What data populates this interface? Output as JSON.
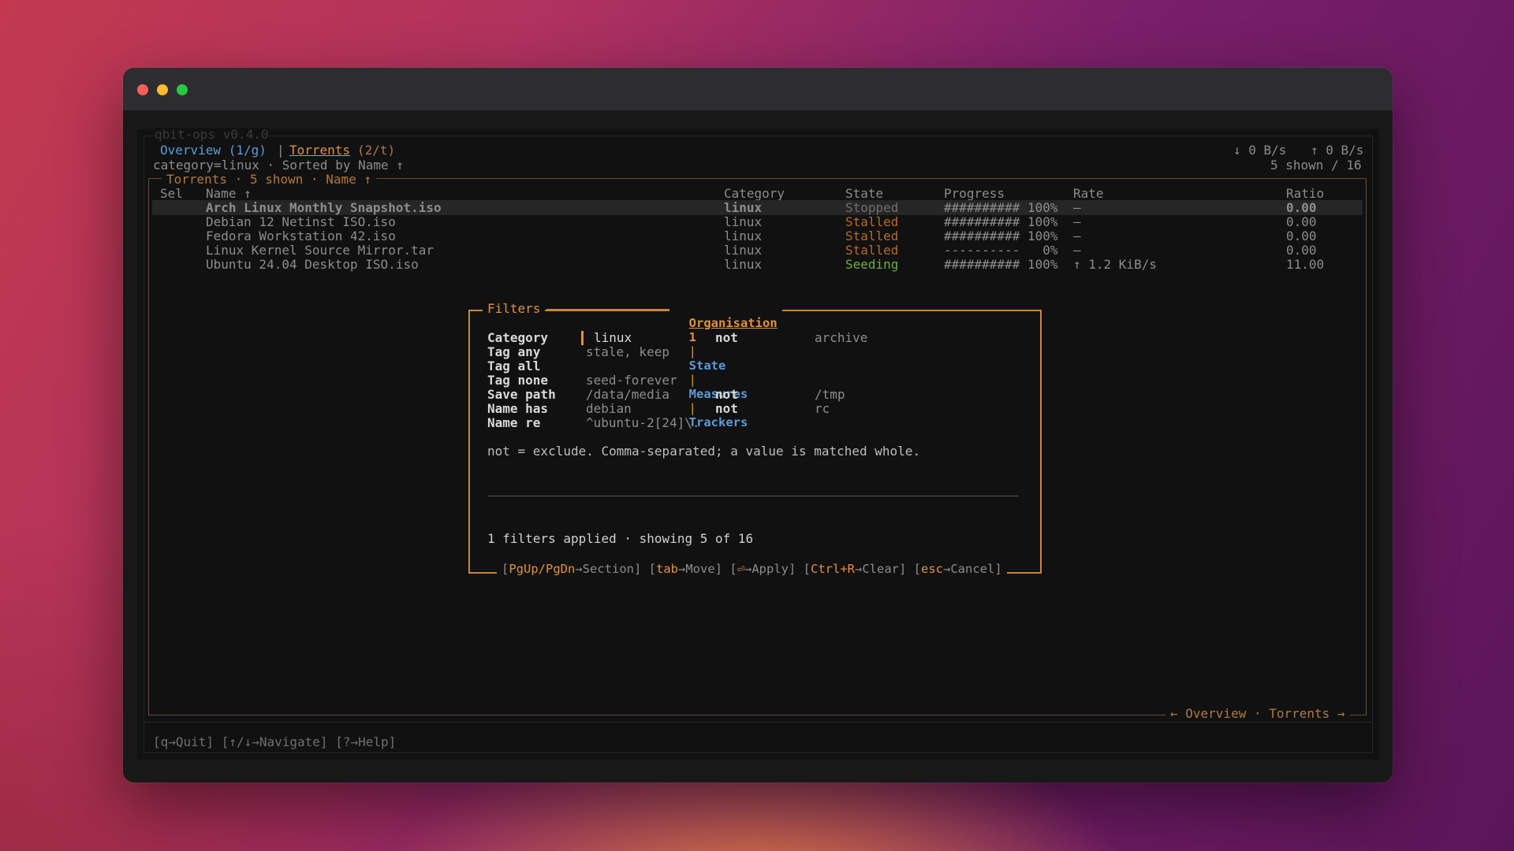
{
  "app": {
    "title": "qbit-ops v0.4.0"
  },
  "tabs": {
    "overview": "Overview (1/g)",
    "sep": "|",
    "torrents": "Torrents",
    "torrents_key": "(2/t)"
  },
  "rates": {
    "down": "↓ 0 B/s",
    "up": "↑ 0 B/s"
  },
  "status_line": "category=linux · Sorted by Name ↑",
  "shown_count": "5 shown / 16",
  "panel_title": "Torrents · 5 shown · Name ↑",
  "table": {
    "headers": {
      "sel": "Sel",
      "name": "Name ↑",
      "category": "Category",
      "state": "State",
      "progress": "Progress",
      "rate": "Rate",
      "ratio": "Ratio"
    },
    "rows": [
      {
        "name": "Arch Linux Monthly Snapshot.iso",
        "category": "linux",
        "state": "Stopped",
        "progress": "########## 100%",
        "rate": "–",
        "ratio": "0.00"
      },
      {
        "name": "Debian 12 Netinst ISO.iso",
        "category": "linux",
        "state": "Stalled",
        "progress": "########## 100%",
        "rate": "–",
        "ratio": "0.00"
      },
      {
        "name": "Fedora Workstation 42.iso",
        "category": "linux",
        "state": "Stalled",
        "progress": "########## 100%",
        "rate": "–",
        "ratio": "0.00"
      },
      {
        "name": "Linux Kernel Source Mirror.tar",
        "category": "linux",
        "state": "Stalled",
        "progress": "----------   0%",
        "rate": "–",
        "ratio": "0.00"
      },
      {
        "name": "Ubuntu 24.04 Desktop ISO.iso",
        "category": "linux",
        "state": "Seeding",
        "progress": "########## 100%",
        "rate": "↑ 1.2 KiB/s",
        "ratio": "11.00"
      }
    ]
  },
  "filters": {
    "title": "Filters",
    "tabs": {
      "organisation": "Organisation",
      "organisation_count": "1",
      "state": "State",
      "measures": "Measures",
      "trackers": "Trackers",
      "sep": "|"
    },
    "fields": {
      "category": {
        "label": "Category",
        "value": "linux",
        "not_label": "not",
        "not_value": "archive"
      },
      "tag_any": {
        "label": "Tag any",
        "value": "stale, keep"
      },
      "tag_all": {
        "label": "Tag all",
        "value": ""
      },
      "tag_none": {
        "label": "Tag none",
        "value": "seed-forever"
      },
      "save_path": {
        "label": "Save path",
        "value": "/data/media",
        "not_label": "not",
        "not_value": "/tmp"
      },
      "name_has": {
        "label": "Name has",
        "value": "debian",
        "not_label": "not",
        "not_value": "rc"
      },
      "name_re": {
        "label": "Name re",
        "value": "^ubuntu-2[24]\\."
      }
    },
    "help": "not = exclude. Comma-separated; a value is matched whole.",
    "summary": "1 filters applied · showing 5 of 16",
    "keys": [
      {
        "key": "PgUp/PgDn",
        "action": "→Section"
      },
      {
        "key": "tab",
        "action": "→Move"
      },
      {
        "key": "⏎",
        "action": "→Apply"
      },
      {
        "key": "Ctrl+R",
        "action": "→Clear"
      },
      {
        "key": "esc",
        "action": "→Cancel"
      }
    ]
  },
  "panel_nav": "← Overview · Torrents →",
  "footer": "[q→Quit] [↑/↓→Navigate] [?→Help]"
}
